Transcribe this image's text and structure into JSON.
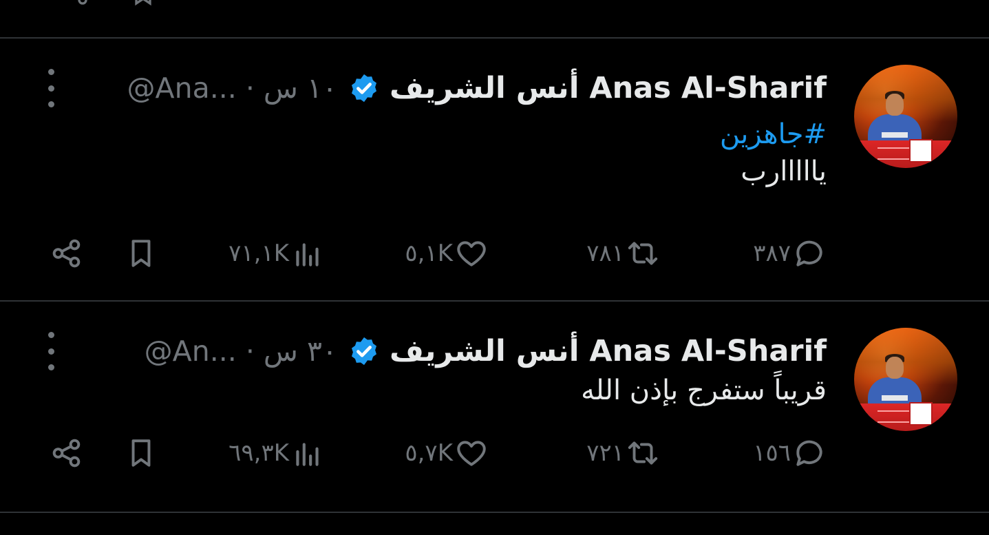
{
  "tweets": [
    {
      "display_name": "أنس الشريف Anas Al-Sharif",
      "handle_time": "@Ana... · ١٠ س",
      "hashtag": "#جاهزين",
      "text": "يااااارب",
      "replies": "٣٨٧",
      "retweets": "٧٨١",
      "likes": "٥,١K",
      "views": "٧١,١K"
    },
    {
      "display_name": "أنس الشريف Anas Al-Sharif",
      "handle_time": "@An... · ٣٠ س",
      "text": "قريباً ستفرج بإذن الله",
      "replies": "١٥٦",
      "retweets": "٧٢١",
      "likes": "٥,٧K",
      "views": "٦٩,٣K"
    }
  ],
  "colors": {
    "background": "#000000",
    "primary_text": "#e7e9ea",
    "secondary_text": "#71767b",
    "accent": "#1d9bf0",
    "divider": "#2f3336"
  },
  "icons": {
    "verified": "verified-badge-icon",
    "more": "more-vertical-icon",
    "reply": "reply-icon",
    "retweet": "retweet-icon",
    "like": "heart-icon",
    "views": "views-icon",
    "bookmark": "bookmark-icon",
    "share": "share-icon"
  }
}
